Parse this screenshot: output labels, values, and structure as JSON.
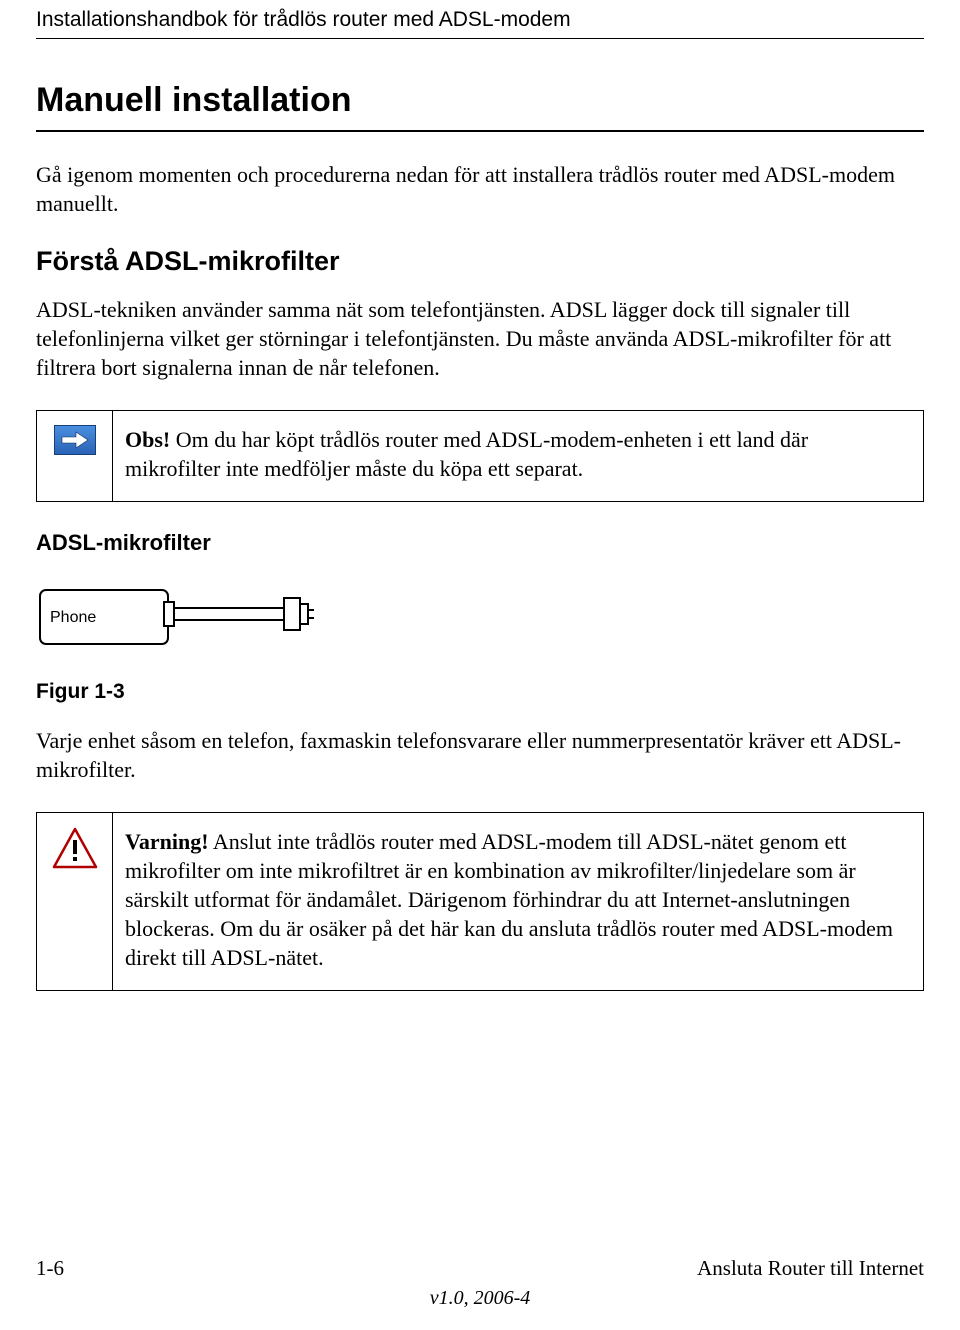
{
  "header": {
    "running_title": "Installationshandbok för trådlös router med ADSL-modem"
  },
  "h1": "Manuell installation",
  "intro": "Gå igenom momenten och procedurerna nedan för att installera trådlös router med ADSL-modem manuellt.",
  "h2": "Förstå ADSL-mikrofilter",
  "body1": "ADSL-tekniken använder samma nät som telefontjänsten. ADSL lägger dock till signaler till telefonlinjerna vilket ger störningar i telefontjänsten. Du måste använda ADSL-mikrofilter för att filtrera bort signalerna innan de når telefonen.",
  "note": {
    "lead": "Obs!",
    "text": " Om du har köpt trådlös router med ADSL-modem-enheten i ett land där mikrofilter inte medföljer måste du köpa ett separat."
  },
  "h3": "ADSL-mikrofilter",
  "figure": {
    "phone_label": "Phone",
    "caption": "Figur 1-3"
  },
  "body2": "Varje enhet såsom en telefon, faxmaskin telefonsvarare eller nummerpresentatör kräver ett ADSL-mikrofilter.",
  "warning": {
    "lead": "Varning!",
    "text": " Anslut inte trådlös router med ADSL-modem till ADSL-nätet genom ett mikrofilter om inte mikrofiltret är en kombination av mikrofilter/linjedelare som är särskilt utformat för ändamålet. Därigenom förhindrar du att Internet-anslutningen blockeras. Om du är osäker på det här kan du ansluta trådlös router med ADSL-modem direkt till ADSL-nätet."
  },
  "footer": {
    "page": "1-6",
    "section": "Ansluta Router till Internet",
    "version": "v1.0, 2006-4"
  }
}
